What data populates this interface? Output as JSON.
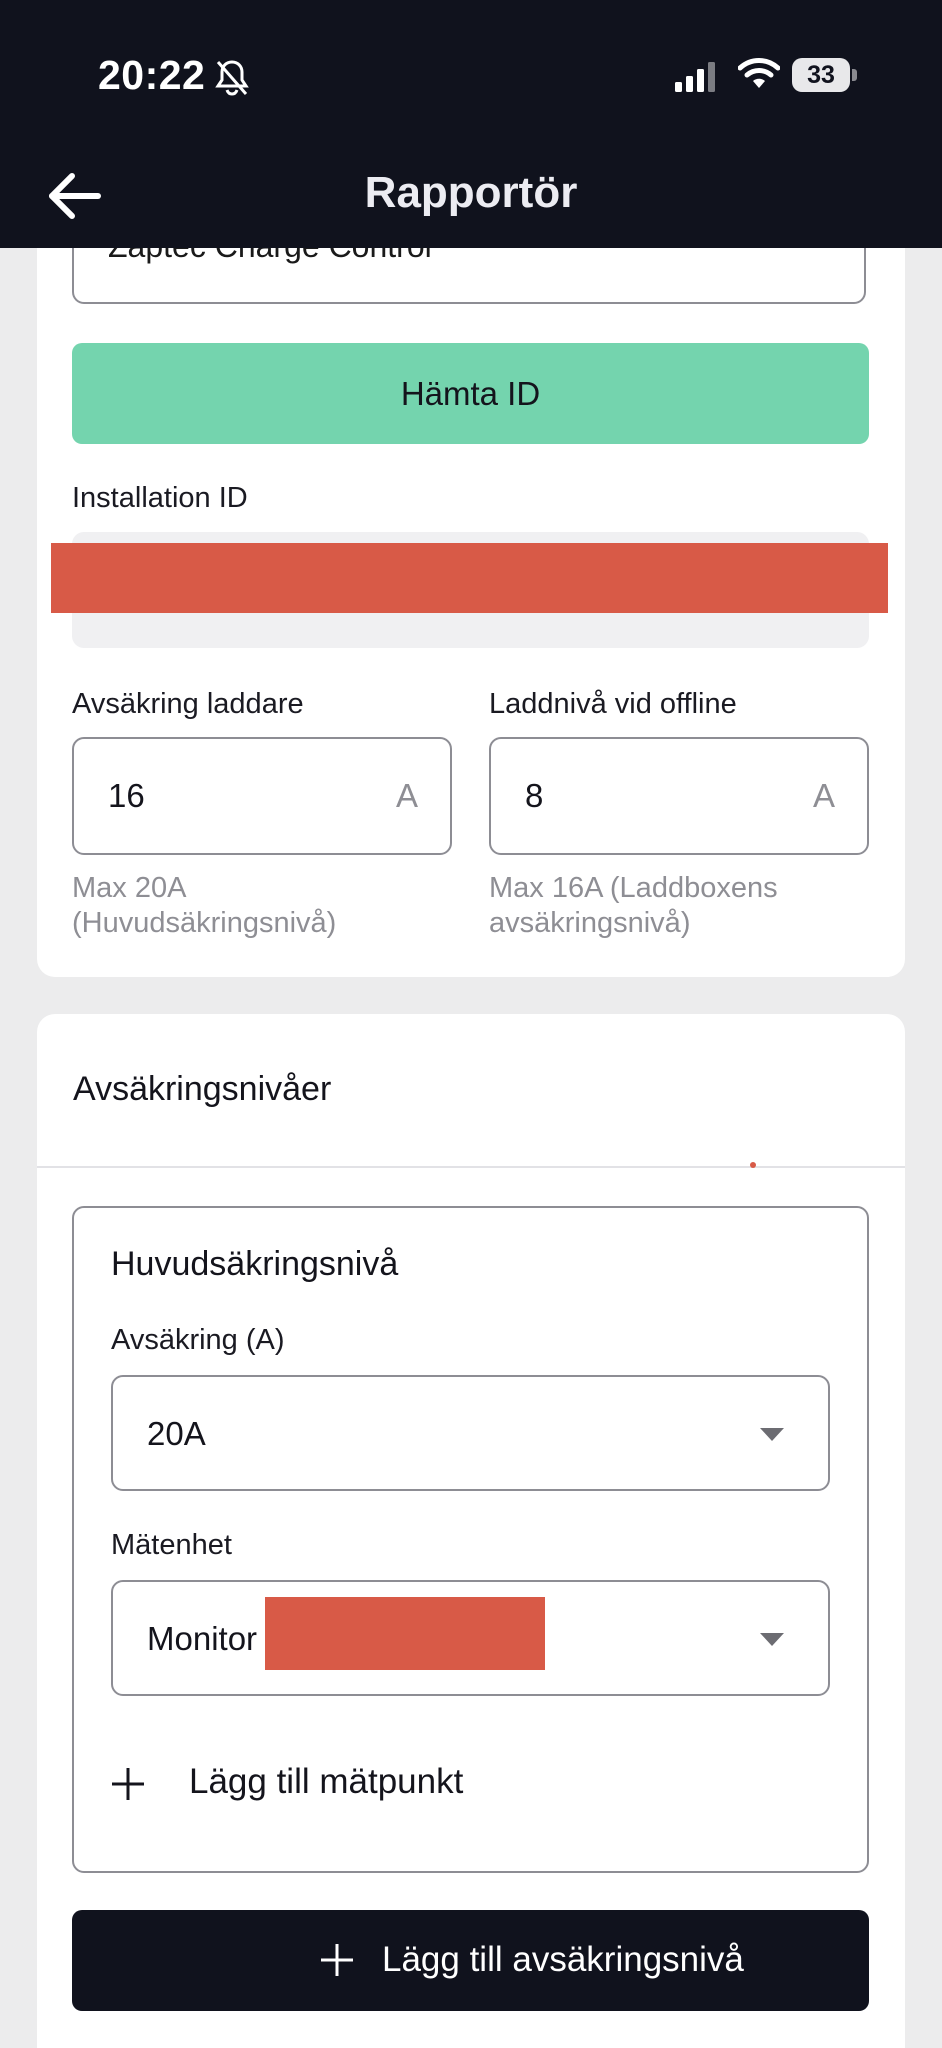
{
  "status_bar": {
    "time": "20:22",
    "battery": "33",
    "icons": [
      "bell-slash-icon",
      "signal-icon",
      "wifi-icon",
      "battery-icon"
    ]
  },
  "header": {
    "title": "Rapportör",
    "back_icon": "arrow-left-icon"
  },
  "charger": {
    "system_value": "Zaptec Charge Control",
    "fetch_id_label": "Hämta ID",
    "installation_id_label": "Installation ID",
    "fuse_label": "Avsäkring laddare",
    "fuse_value": "16",
    "fuse_unit": "A",
    "fuse_hint": "Max 20A (Huvudsäkringsnivå)",
    "offline_label": "Laddnivå vid offline",
    "offline_value": "8",
    "offline_unit": "A",
    "offline_hint": "Max 16A (Laddboxens avsäkringsnivå)"
  },
  "fuse_levels": {
    "section_title": "Avsäkringsnivåer",
    "level": {
      "title": "Huvudsäkringsnivå",
      "fuse_label": "Avsäkring (A)",
      "fuse_selected": "20A",
      "meter_label": "Mätenhet",
      "meter_selected": "Monitor",
      "add_measure_point": "Lägg till mätpunkt"
    },
    "add_level_button": "Lägg till avsäkringsnivå"
  },
  "colors": {
    "header_bg": "#10121d",
    "primary_green": "#74d4ae",
    "redaction": "#d85a47",
    "background": "#ececed"
  }
}
